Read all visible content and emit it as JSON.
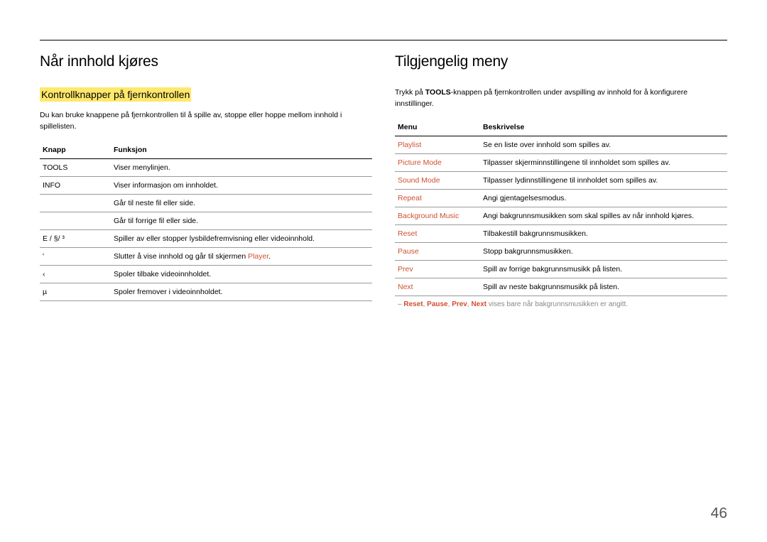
{
  "page_number": "46",
  "left": {
    "heading": "Når innhold kjøres",
    "subheading": "Kontrollknapper på fjernkontrollen",
    "intro": "Du kan bruke knappene på fjernkontrollen til å spille av, stoppe eller hoppe mellom innhold i spillelisten.",
    "th1": "Knapp",
    "th2": "Funksjon",
    "rows": [
      {
        "k": "TOOLS",
        "f": "Viser menylinjen."
      },
      {
        "k": "INFO",
        "f": "Viser informasjon om innholdet."
      },
      {
        "k": "",
        "f": "Går til neste fil eller side."
      },
      {
        "k": "",
        "f": "Går til forrige fil eller side."
      },
      {
        "k": "E / §/ ³",
        "f": "Spiller av eller stopper lysbildefremvisning eller videoinnhold."
      },
      {
        "k": "'",
        "f_prefix": "Slutter å vise innhold og går til skjermen ",
        "f_accent": "Player",
        "f_suffix": "."
      },
      {
        "k": "‹",
        "f": "Spoler tilbake videoinnholdet."
      },
      {
        "k": "µ",
        "f": "Spoler fremover i videoinnholdet."
      }
    ]
  },
  "right": {
    "heading": "Tilgjengelig meny",
    "intro_prefix": "Trykk på ",
    "intro_bold": "TOOLS",
    "intro_suffix": "-knappen på fjernkontrollen under avspilling av innhold for å konfigurere innstillinger.",
    "th1": "Menu",
    "th2": "Beskrivelse",
    "rows": [
      {
        "m": "Playlist",
        "d": "Se en liste over innhold som spilles av."
      },
      {
        "m": "Picture Mode",
        "d": "Tilpasser skjerminnstillingene til innholdet som spilles av."
      },
      {
        "m": "Sound Mode",
        "d": "Tilpasser lydinnstillingene til innholdet som spilles av."
      },
      {
        "m": "Repeat",
        "d": "Angi gjentagelsesmodus."
      },
      {
        "m": "Background Music",
        "d": "Angi bakgrunnsmusikken som skal spilles av når innhold kjøres."
      },
      {
        "m": "Reset",
        "d": "Tilbakestill bakgrunnsmusikken."
      },
      {
        "m": "Pause",
        "d": "Stopp bakgrunnsmusikken."
      },
      {
        "m": "Prev",
        "d": "Spill av forrige bakgrunnsmusikk på listen."
      },
      {
        "m": "Next",
        "d": "Spill av neste bakgrunnsmusikk på listen."
      }
    ],
    "footnote_dash": "– ",
    "footnote_items": [
      "Reset",
      "Pause",
      "Prev",
      "Next"
    ],
    "footnote_sep": ", ",
    "footnote_tail": " vises bare når bakgrunnsmusikken er angitt."
  }
}
